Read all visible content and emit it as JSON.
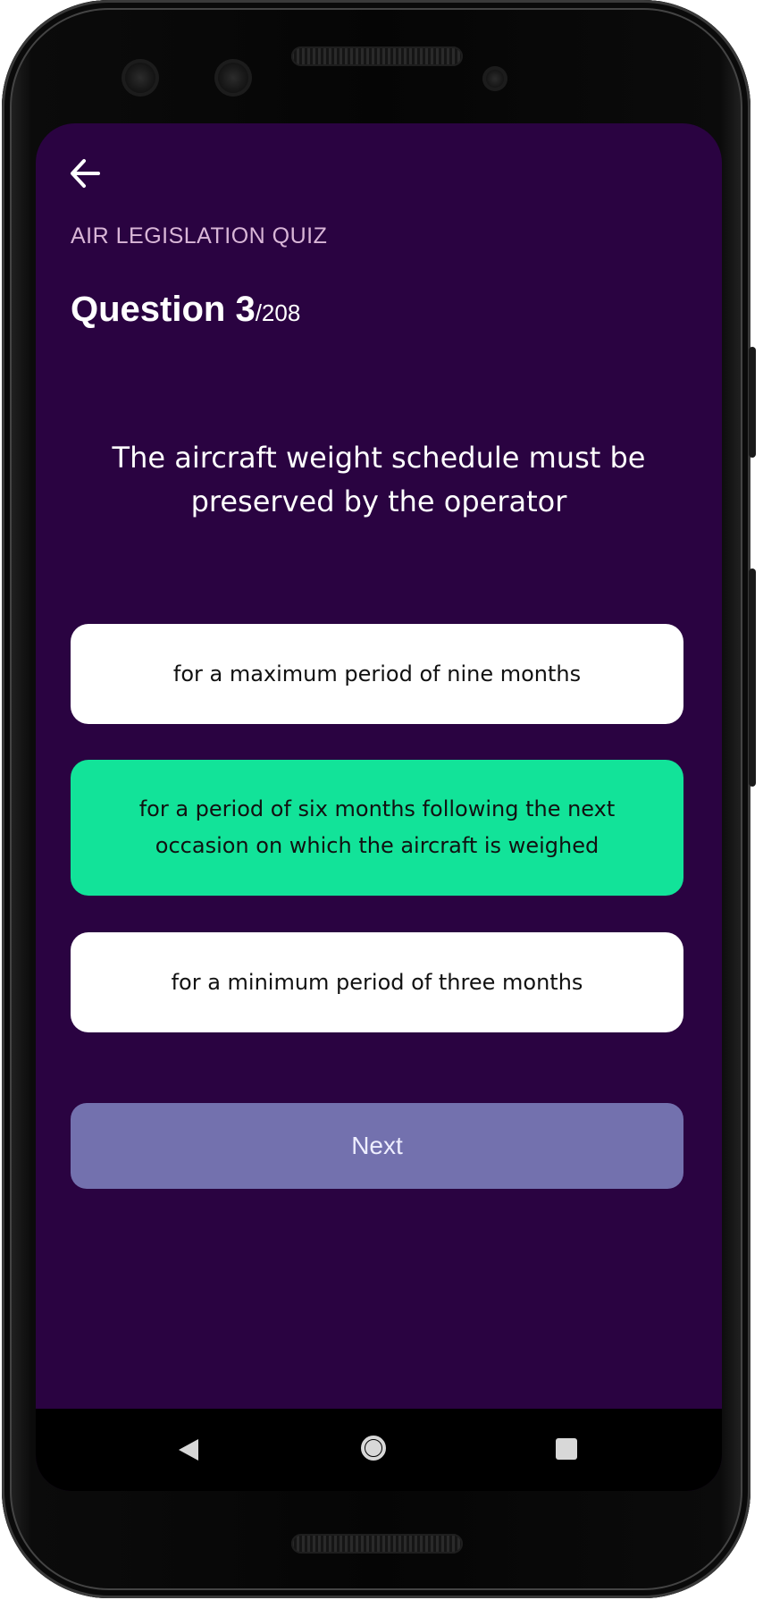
{
  "header": {
    "quiz_label": "AIR LEGISLATION QUIZ",
    "question_prefix": "Question 3",
    "question_total": "/208"
  },
  "question": {
    "text": "The aircraft weight schedule must be preserved by the operator"
  },
  "answers": [
    {
      "label": "for a maximum period of nine months",
      "selected": false
    },
    {
      "label": "for a period of six months following the next occasion on which the aircraft is weighed",
      "selected": true
    },
    {
      "label": "for a minimum period of three months",
      "selected": false
    }
  ],
  "actions": {
    "next_label": "Next"
  },
  "icons": {
    "back": "arrow-left-icon",
    "nav_back": "triangle-back-icon",
    "nav_home": "circle-home-icon",
    "nav_recent": "square-recent-icon"
  },
  "colors": {
    "background": "#2a0341",
    "selected_answer": "#12e399",
    "next_button": "#7371ae",
    "quiz_label": "#d9b6d7"
  }
}
